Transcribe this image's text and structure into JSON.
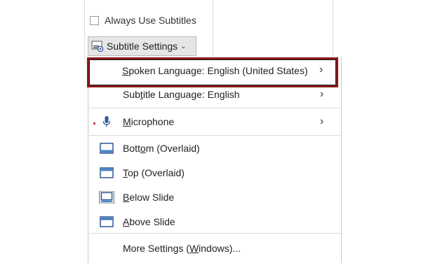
{
  "ribbon": {
    "always_use_subtitles_label": "Always Use Subtitles",
    "always_use_subtitles_checked": false,
    "subtitle_settings_label": "Subtitle Settings",
    "subtitle_settings_chevron": "⌄"
  },
  "menu": {
    "items": [
      {
        "id": "spoken-language",
        "pre": "",
        "ul": "S",
        "post": "poken Language: English (United States)",
        "arrow": "›",
        "icon": "none"
      },
      {
        "id": "subtitle-language",
        "pre": "Sub",
        "ul": "t",
        "post": "itle Language: English",
        "arrow": "›",
        "icon": "none"
      },
      {
        "id": "microphone",
        "pre": "",
        "ul": "M",
        "post": "icrophone",
        "arrow": "›",
        "icon": "microphone-icon"
      },
      {
        "id": "bottom-overlaid",
        "pre": "Bott",
        "ul": "o",
        "post": "m (Overlaid)",
        "arrow": "",
        "icon": "bottom-overlaid-icon"
      },
      {
        "id": "top-overlaid",
        "pre": "",
        "ul": "T",
        "post": "op (Overlaid)",
        "arrow": "",
        "icon": "top-overlaid-icon"
      },
      {
        "id": "below-slide",
        "pre": "",
        "ul": "B",
        "post": "elow Slide",
        "arrow": "",
        "icon": "below-slide-icon"
      },
      {
        "id": "above-slide",
        "pre": "",
        "ul": "A",
        "post": "bove Slide",
        "arrow": "",
        "icon": "above-slide-icon"
      },
      {
        "id": "more-settings",
        "pre": "More Settings (",
        "ul": "W",
        "post": "indows)...",
        "arrow": "",
        "icon": "none"
      }
    ]
  },
  "colors": {
    "highlight_border": "#8b1a1a",
    "icon_blue": "#2b5797",
    "icon_fill_blue": "#4a86c8"
  }
}
